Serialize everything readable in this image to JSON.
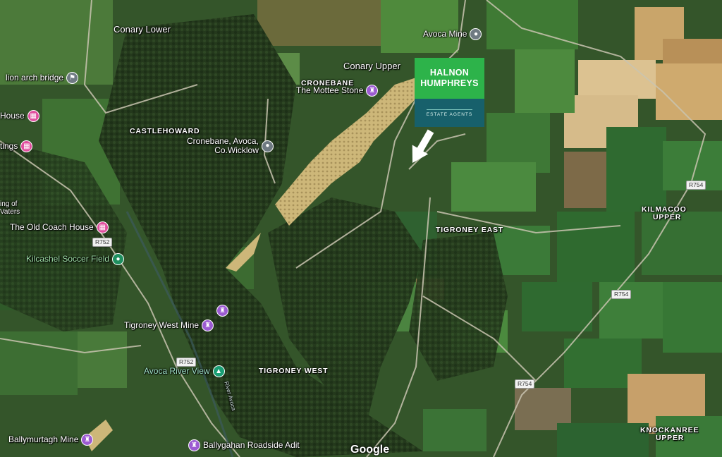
{
  "map": {
    "type": "satellite",
    "attribution": "Google",
    "brand": {
      "line1": "HALNON",
      "line2": "HUMPHREYS",
      "line3": "ESTATE AGENTS",
      "color_top": "#2db34a",
      "color_bottom": "#17606b"
    },
    "places": [
      {
        "id": "conary-lower",
        "text": "Conary Lower"
      },
      {
        "id": "conary-upper",
        "text": "Conary Upper"
      },
      {
        "id": "cronebane",
        "text": "CRONEBANE"
      },
      {
        "id": "castlehoward",
        "text": "CASTLEHOWARD"
      },
      {
        "id": "tigroney-east",
        "text": "TIGRONEY EAST"
      },
      {
        "id": "tigroney-west",
        "text": "TIGRONEY WEST"
      },
      {
        "id": "kilmacoo",
        "text": "KILMACOO"
      },
      {
        "id": "kilmacoo-upper",
        "text": "UPPER"
      },
      {
        "id": "knockanree",
        "text": "KNOCKANREE"
      },
      {
        "id": "knockanree-upper",
        "text": "UPPER"
      },
      {
        "id": "ing-of",
        "text": "ing of"
      },
      {
        "id": "vaters",
        "text": "Vaters"
      }
    ],
    "pois": [
      {
        "id": "avoca-mine",
        "text": "Avoca Mine",
        "icon": "location-pin-icon",
        "color": "#6f7a82"
      },
      {
        "id": "lion-arch-bridge",
        "text": "lion arch bridge",
        "icon": "landmark-icon",
        "color": "#6f7a82"
      },
      {
        "id": "mottee-stone",
        "text": "The Mottee Stone",
        "icon": "monument-icon",
        "color": "#9c5bd2"
      },
      {
        "id": "cronebane-avoca-1",
        "text": "Cronebane, Avoca,",
        "icon": "location-pin-icon",
        "color": "#6f7a82"
      },
      {
        "id": "cronebane-avoca-2",
        "text": "Co.Wicklow"
      },
      {
        "id": "house",
        "text": "House",
        "icon": "bed-icon",
        "color": "#e04f9e"
      },
      {
        "id": "tings",
        "text": "tings",
        "icon": "bed-icon",
        "color": "#e04f9e"
      },
      {
        "id": "old-coach-house",
        "text": "The Old Coach House",
        "icon": "bed-icon",
        "color": "#e04f9e"
      },
      {
        "id": "kilcashel",
        "text": "Kilcashel Soccer Field",
        "icon": "sports-icon",
        "color": "#1f8f5f"
      },
      {
        "id": "monument-small",
        "text": "",
        "icon": "monument-icon",
        "color": "#9c5bd2"
      },
      {
        "id": "tigroney-west-mine",
        "text": "Tigroney West Mine",
        "icon": "monument-icon",
        "color": "#9c5bd2"
      },
      {
        "id": "avoca-river-view",
        "text": "Avoca River View",
        "icon": "park-icon",
        "color": "#1a9e74"
      },
      {
        "id": "ballymurtagh-mine",
        "text": "Ballymurtagh Mine",
        "icon": "monument-icon",
        "color": "#9c5bd2"
      },
      {
        "id": "ballygahan-adit",
        "text": "Ballygahan Roadside Adit",
        "icon": "monument-icon",
        "color": "#9c5bd2"
      }
    ],
    "roads": [
      {
        "id": "r752a",
        "text": "R752"
      },
      {
        "id": "r752b",
        "text": "R752"
      },
      {
        "id": "r754a",
        "text": "R754"
      },
      {
        "id": "r754b",
        "text": "R754"
      },
      {
        "id": "r754c",
        "text": "R754"
      }
    ],
    "river_label": "River Avoca"
  }
}
